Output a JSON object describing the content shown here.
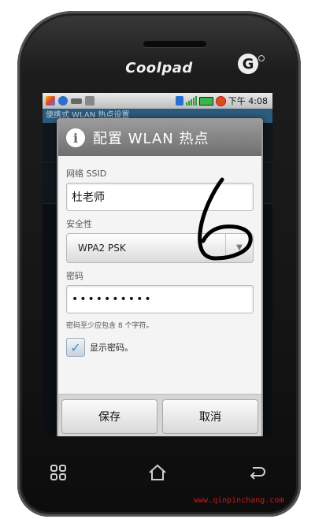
{
  "device": {
    "brand": "Coolpad",
    "carrier_logo": "G"
  },
  "status_bar": {
    "time": "下午 4:08",
    "icons": [
      "app-icon",
      "wifi-icon",
      "usb-icon",
      "notification-icon",
      "network-icon",
      "signal-icon",
      "battery-icon",
      "alarm-icon"
    ]
  },
  "background_screen": {
    "header": "便携式 WLAN 热点设置"
  },
  "dialog": {
    "title": "配置 WLAN 热点",
    "ssid_label": "网络 SSID",
    "ssid_value": "杜老师",
    "security_label": "安全性",
    "security_value": "WPA2 PSK",
    "password_label": "密码",
    "password_value": "••••••••••",
    "password_hint": "密码至少应包含 8 个字符。",
    "show_password_label": "显示密码。",
    "show_password_checked": true,
    "save_label": "保存",
    "cancel_label": "取消"
  },
  "annotation": {
    "handwritten": "6"
  },
  "watermark": "www.qinpinchang.com",
  "colors": {
    "title_bar": "#7f7f7f",
    "check": "#3a8bd8",
    "watermark": "#d01818"
  }
}
